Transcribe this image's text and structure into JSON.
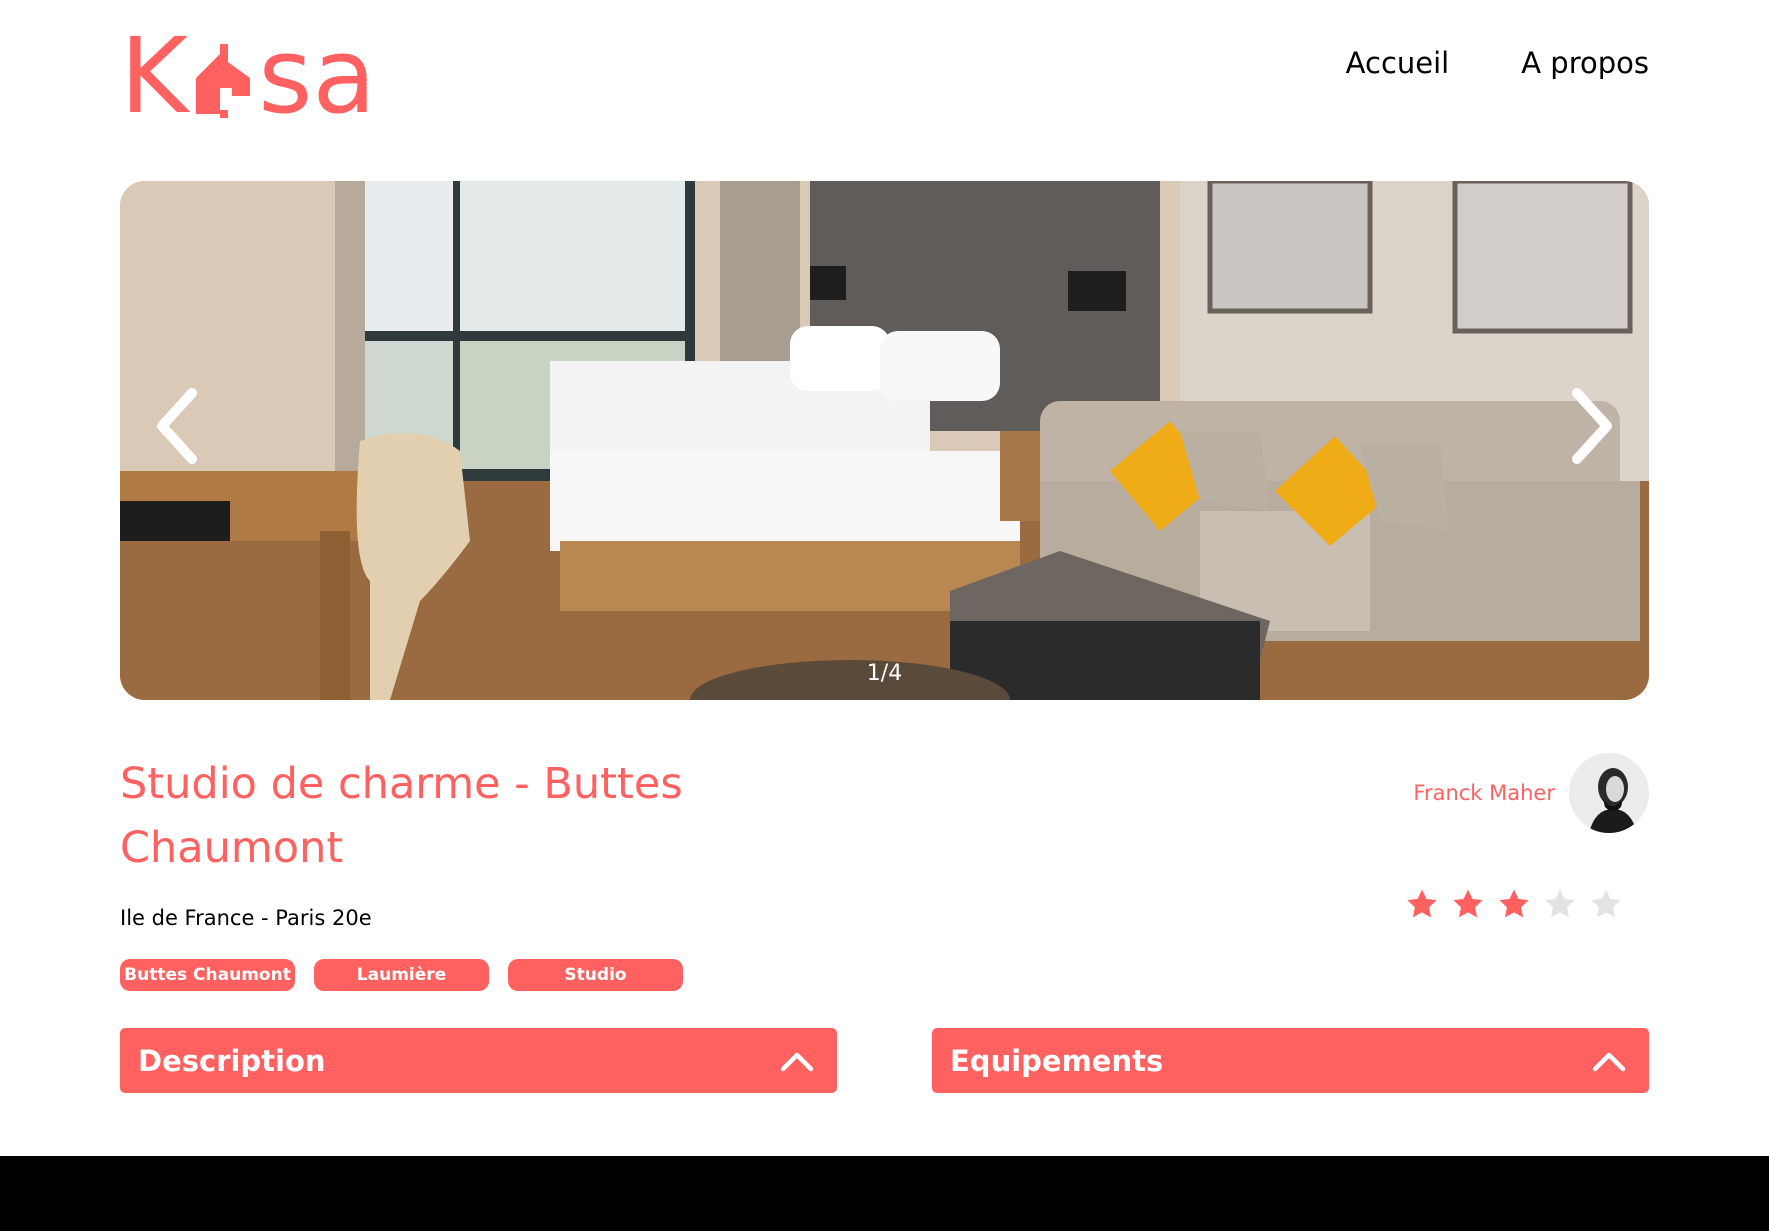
{
  "brand": {
    "logo_left": "K",
    "logo_right": "sa",
    "accent_color": "#ff6060"
  },
  "nav": {
    "items": [
      "Accueil",
      "A propos"
    ]
  },
  "carousel": {
    "counter": "1/4",
    "prev_icon": "chevron-left-icon",
    "next_icon": "chevron-right-icon"
  },
  "listing": {
    "title": "Studio de charme - Buttes Chaumont",
    "location": "Ile de France - Paris 20e",
    "tags": [
      "Buttes Chaumont",
      "Laumière",
      "Studio"
    ],
    "host_name": "Franck Maher",
    "rating": 3,
    "rating_max": 5,
    "star_filled_color": "#ff6060",
    "star_empty_color": "#e3e3e3"
  },
  "collapses": {
    "description_label": "Description",
    "equipements_label": "Equipements"
  }
}
